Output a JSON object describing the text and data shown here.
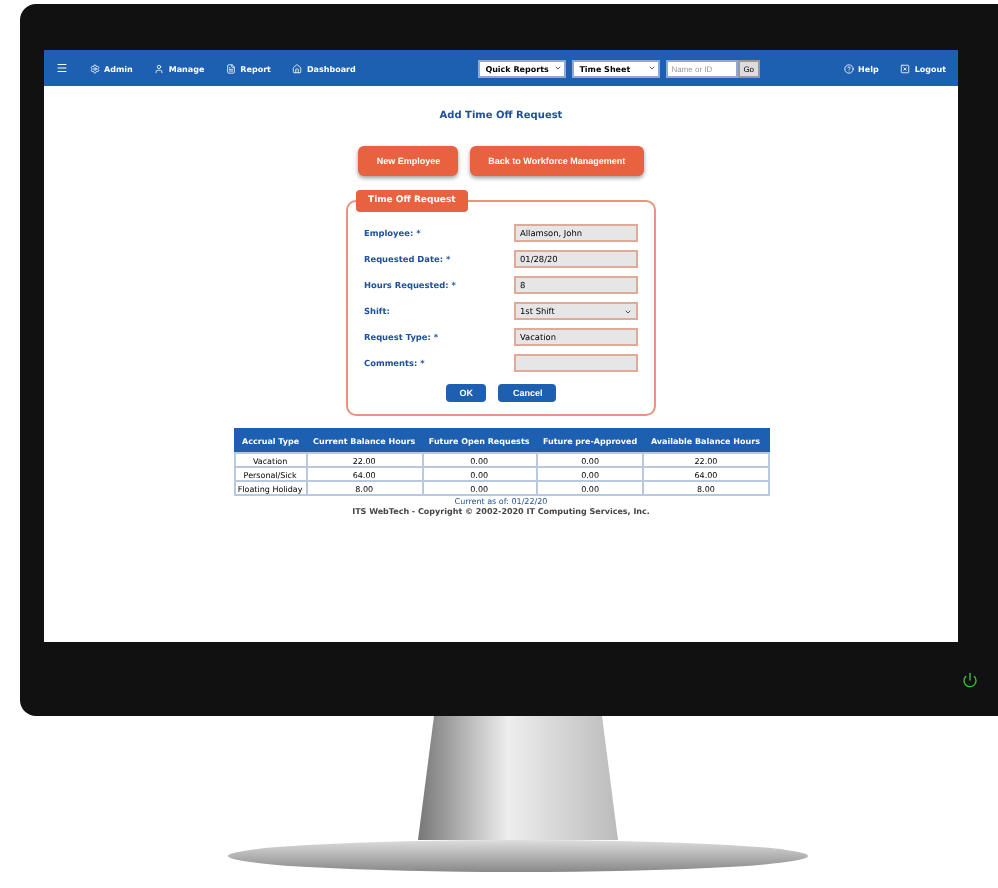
{
  "navbar": {
    "menu_items": [
      {
        "kind": "admin",
        "label": "Admin"
      },
      {
        "kind": "manage",
        "label": "Manage"
      },
      {
        "kind": "report",
        "label": "Report"
      },
      {
        "kind": "dashboard",
        "label": "Dashboard"
      }
    ],
    "quick_reports": "Quick Reports",
    "time_sheet": "Time Sheet",
    "search": {
      "placeholder": "Name or ID"
    },
    "go": "Go",
    "help": "Help",
    "logout": "Logout"
  },
  "title": "Add Time Off Request",
  "buttons": [
    "New Employee",
    "Back to Workforce Management"
  ],
  "form": {
    "legend": "Time Off Request",
    "fields": [
      {
        "kind": "text",
        "label": "Employee: *",
        "value": "Allamson, John"
      },
      {
        "kind": "text",
        "label": "Requested Date: *",
        "value": "01/28/20"
      },
      {
        "kind": "text",
        "label": "Hours Requested: *",
        "value": "8"
      },
      {
        "kind": "select",
        "label": "Shift:",
        "value": "1st Shift"
      },
      {
        "kind": "text",
        "label": "Request Type: *",
        "value": "Vacation"
      },
      {
        "kind": "text",
        "label": "Comments: *"
      }
    ],
    "ok": "OK",
    "cancel": "Cancel"
  },
  "table": {
    "columns": [
      "Accrual Type",
      "Current Balance Hours",
      "Future Open Requests",
      "Future pre-Approved",
      "Available Balance Hours"
    ],
    "rows": [
      [
        "Vacation",
        "22.00",
        "0.00",
        "0.00",
        "22.00"
      ],
      [
        "Personal/Sick",
        "64.00",
        "0.00",
        "0.00",
        "64.00"
      ],
      [
        "Floating Holiday",
        "8.00",
        "0.00",
        "0.00",
        "8.00"
      ]
    ]
  },
  "current_as_of": "Current as of: 01/22/20",
  "footer": "ITS WebTech - Copyright © 2002-2020 IT Computing Services, Inc."
}
